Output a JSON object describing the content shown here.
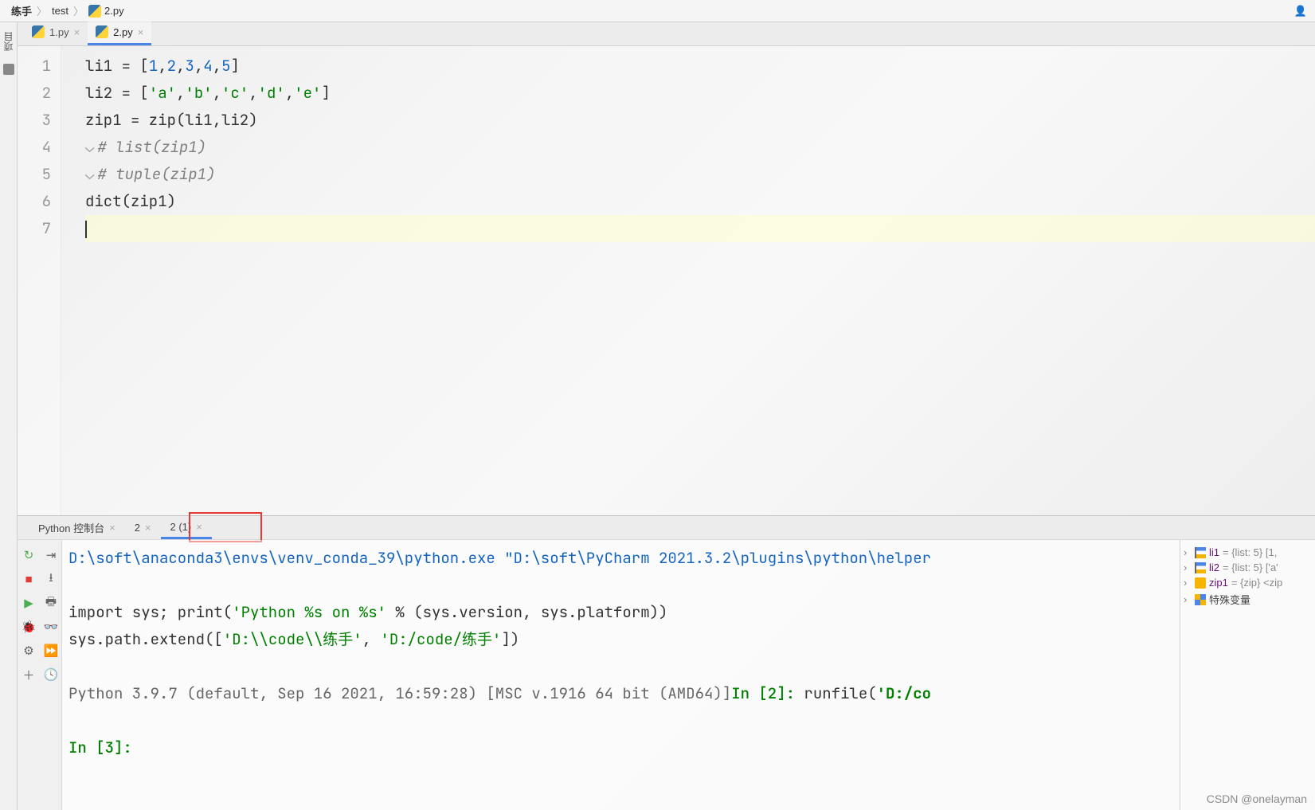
{
  "breadcrumb": {
    "items": [
      "练手",
      "test",
      "2.py"
    ]
  },
  "sidebar": {
    "project_label": "项目"
  },
  "editor": {
    "tabs": [
      {
        "label": "1.py",
        "active": false
      },
      {
        "label": "2.py",
        "active": true
      }
    ],
    "gutter": [
      "1",
      "2",
      "3",
      "4",
      "5",
      "6",
      "7"
    ],
    "code": {
      "l1_a": "li1 = [",
      "l1_nums": [
        "1",
        "2",
        "3",
        "4",
        "5"
      ],
      "l1_b": "]",
      "l2_a": "li2 = [",
      "l2_strs": [
        "'a'",
        "'b'",
        "'c'",
        "'d'",
        "'e'"
      ],
      "l2_b": "]",
      "l3": "zip1 = zip(li1,li2)",
      "l4": "# list(zip1)",
      "l5": "# tuple(zip1)",
      "l6": "dict(zip1)"
    }
  },
  "console": {
    "tabs": [
      {
        "label": "Python 控制台",
        "active": false
      },
      {
        "label": "2",
        "active": false
      },
      {
        "label": "2 (1)",
        "active": true
      }
    ],
    "output": {
      "exec_path": "D:\\soft\\anaconda3\\envs\\venv_conda_39\\python.exe \"D:\\soft\\PyCharm 2021.3.2\\plugins\\python\\helper",
      "import_line_a": "import sys; print(",
      "import_line_b": "'Python %s on %s'",
      "import_line_c": " % (sys.version, sys.platform))",
      "extend_a": "sys.path.extend([",
      "extend_b": "'D:\\\\code\\\\练手'",
      "extend_c": ", ",
      "extend_d": "'D:/code/练手'",
      "extend_e": "])",
      "ver_line": "Python 3.9.7 (default, Sep 16 2021, 16:59:28) [MSC v.1916 64 bit (AMD64)]",
      "in2": "In [2]:",
      "runfile_a": " runfile(",
      "runfile_b": "'D:/co",
      "in3": "In [3]:"
    }
  },
  "vars": {
    "rows": [
      {
        "name": "li1",
        "meta": " = {list: 5} [1,"
      },
      {
        "name": "li2",
        "meta": " = {list: 5} ['a'"
      },
      {
        "name": "zip1",
        "meta": " = {zip} <zip"
      },
      {
        "name": "特殊变量",
        "meta": ""
      }
    ]
  },
  "watermark": "CSDN @onelayman"
}
